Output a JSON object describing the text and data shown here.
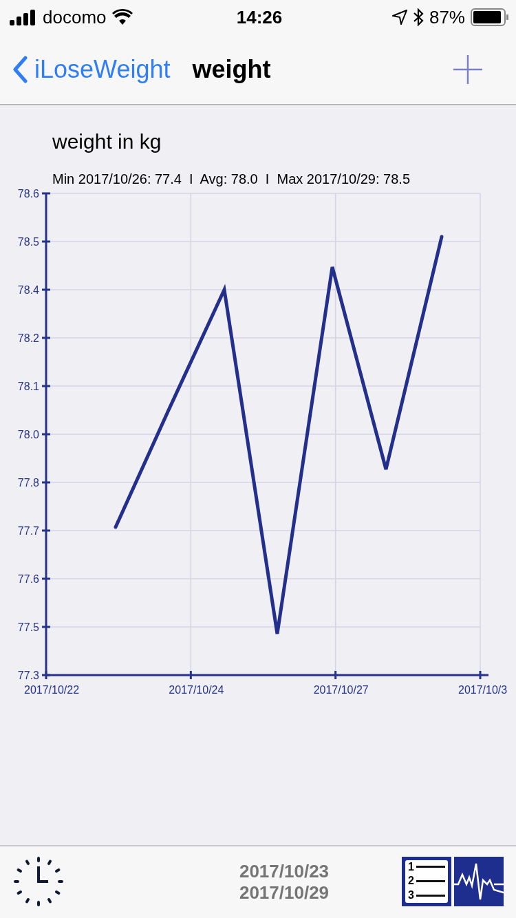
{
  "status_bar": {
    "carrier": "docomo",
    "time": "14:26",
    "battery": "87%"
  },
  "nav": {
    "back": "iLoseWeight",
    "title": "weight"
  },
  "chart": {
    "heading": "weight in kg",
    "summary": "Min 2017/10/26: 77.4  I  Avg: 78.0  I  Max 2017/10/29: 78.5",
    "y_axis_labels": [
      "78.6",
      "78.5",
      "78.4",
      "78.2",
      "78.1",
      "78.0",
      "77.8",
      "77.7",
      "77.6",
      "77.5",
      "77.3"
    ],
    "x_axis_labels": [
      "2017/10/22",
      "2017/10/24",
      "2017/10/27",
      "2017/10/3"
    ]
  },
  "bottom_bar": {
    "date_from": "2017/10/23",
    "date_to": "2017/10/29",
    "list_numbers": [
      "1",
      "2",
      "3"
    ]
  }
}
